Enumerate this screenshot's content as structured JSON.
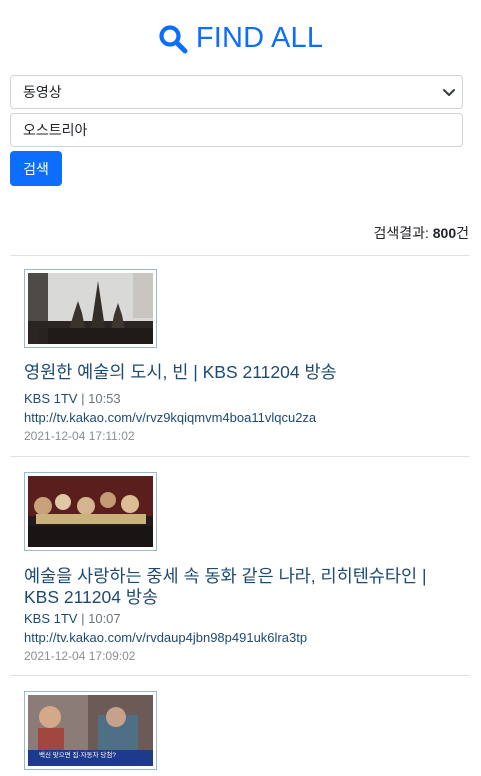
{
  "header": {
    "title": "FIND ALL",
    "icon": "search-icon",
    "color": "#0d6efd"
  },
  "form": {
    "category": {
      "selected": "동영상"
    },
    "query": {
      "value": "오스트리아"
    },
    "submit_label": "검색"
  },
  "summary": {
    "label": "검색결과:",
    "count": "800",
    "unit": "건"
  },
  "results": [
    {
      "title": "영원한 예술의 도시, 빈 | KBS 211204 방송",
      "channel": "KBS 1TV",
      "separator": "|",
      "duration": "10:53",
      "url": "http://tv.kakao.com/v/rvz9kqiqmvm4boa11vlqcu2za",
      "date": "2021-12-04 17:11:02"
    },
    {
      "title": "예술을 사랑하는 중세 속 동화 같은 나라, 리히텐슈타인 | KBS 211204 방송",
      "channel": "KBS 1TV",
      "separator": "|",
      "duration": "10:07",
      "url": "http://tv.kakao.com/v/rvdaup4jbn98p491uk6lra3tp",
      "date": "2021-12-04 17:09:02"
    },
    {
      "thumb_caption": "백신 맞으면 집·자동차 당첨?"
    }
  ]
}
